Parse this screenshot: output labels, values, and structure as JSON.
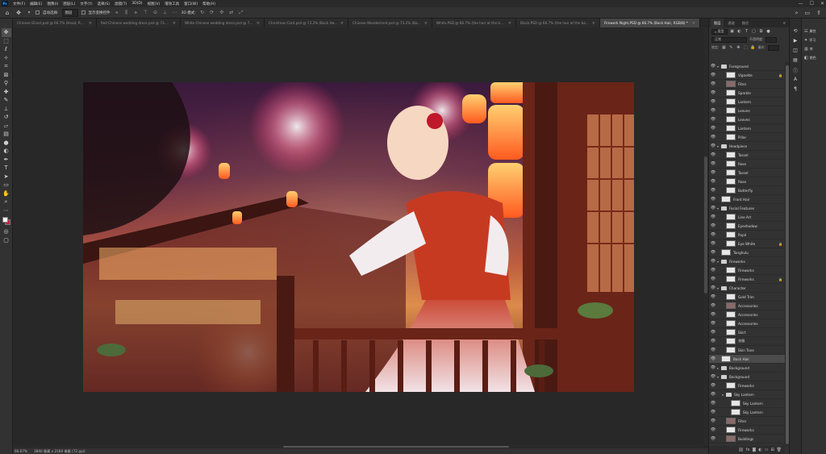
{
  "app": {
    "logo": "Ps"
  },
  "menu": [
    "文件(F)",
    "编辑(E)",
    "图像(I)",
    "图层(L)",
    "文字(Y)",
    "选择(S)",
    "滤镜(T)",
    "3D(D)",
    "视图(V)",
    "增效工具",
    "窗口(W)",
    "帮助(H)"
  ],
  "window_controls": {
    "minimize": "—",
    "maximize": "☐",
    "close": "✕"
  },
  "options": {
    "auto_select_label": "自动选择:",
    "auto_select_value": "图层",
    "show_transform_label": "显示变换控件",
    "mode_label": "3D 模式:"
  },
  "tabs": [
    {
      "label": "Chinese Ghost.psd @ 66.7% (Head, RGB/...",
      "close": "×"
    },
    {
      "label": "Red Chinese wedding dress.psd @ 73.2...",
      "close": "×"
    },
    {
      "label": "White Chinese wedding dress.psd @ 73....",
      "close": "×"
    },
    {
      "label": "Christmas Card.psd @ 73.2% (Back Hair...",
      "close": "×"
    },
    {
      "label": "Chinese Wonderland.psd @ 73.2% (Ba...",
      "close": "×"
    },
    {
      "label": "White.PSD @ 66.7% (the hair at the bac...",
      "close": "×"
    },
    {
      "label": "Black.PSD @ 66.7% (the hair at the back...",
      "close": "×"
    },
    {
      "label": "Firework Night.PSD @ 66.7% (Back Hair, RGB/8) *",
      "close": "×"
    }
  ],
  "status": {
    "zoom": "66.67%",
    "doc_info": "3840 像素 x 2160 像素 (72 ppi)"
  },
  "colors": {
    "foreground": "#ffffff",
    "background": "#c2253c",
    "accent": "#31a8ff"
  },
  "layers_panel": {
    "tabs": [
      "图层",
      "通道",
      "路径"
    ],
    "kind_label": "类型",
    "blend_mode": "正常",
    "opacity_label": "不透明度:",
    "lock_label": "锁定:",
    "fill_label": "填充:"
  },
  "layers": [
    {
      "name": "Foreground",
      "type": "group",
      "indent": 0,
      "open": true
    },
    {
      "name": "Vignette",
      "type": "layer",
      "indent": 1,
      "lock": true
    },
    {
      "name": "Filter",
      "type": "layer",
      "indent": 1,
      "dark": true
    },
    {
      "name": "Sparkle",
      "type": "layer",
      "indent": 1
    },
    {
      "name": "Lantern",
      "type": "layer",
      "indent": 1
    },
    {
      "name": "Leaves",
      "type": "layer",
      "indent": 1
    },
    {
      "name": "Leaves",
      "type": "layer",
      "indent": 1
    },
    {
      "name": "Lantern",
      "type": "layer",
      "indent": 1
    },
    {
      "name": "Pillar",
      "type": "layer",
      "indent": 1
    },
    {
      "name": "Headpiece",
      "type": "group",
      "indent": 0,
      "open": true
    },
    {
      "name": "Tassel",
      "type": "layer",
      "indent": 1
    },
    {
      "name": "Rose",
      "type": "layer",
      "indent": 1
    },
    {
      "name": "Tassel",
      "type": "layer",
      "indent": 1
    },
    {
      "name": "Rose",
      "type": "layer",
      "indent": 1
    },
    {
      "name": "Butterfly",
      "type": "layer",
      "indent": 1
    },
    {
      "name": "Front Hair",
      "type": "layer",
      "indent": 0
    },
    {
      "name": "Facial Features",
      "type": "group",
      "indent": 0,
      "open": true
    },
    {
      "name": "Line Art",
      "type": "layer",
      "indent": 1
    },
    {
      "name": "Eyeshadow",
      "type": "layer",
      "indent": 1
    },
    {
      "name": "Pupil",
      "type": "layer",
      "indent": 1
    },
    {
      "name": "Eye White",
      "type": "layer",
      "indent": 1,
      "lock": true
    },
    {
      "name": "Tanghulu",
      "type": "layer",
      "indent": 0
    },
    {
      "name": "Fireworks",
      "type": "group",
      "indent": 0,
      "open": true
    },
    {
      "name": "Fireworks",
      "type": "layer",
      "indent": 1
    },
    {
      "name": "Fireworks",
      "type": "layer",
      "indent": 1,
      "lock": true
    },
    {
      "name": "Character",
      "type": "group",
      "indent": 0,
      "open": true
    },
    {
      "name": "Gold Trim",
      "type": "layer",
      "indent": 1
    },
    {
      "name": "Accessories",
      "type": "layer",
      "indent": 1,
      "dark": true
    },
    {
      "name": "Accessories",
      "type": "layer",
      "indent": 1
    },
    {
      "name": "Accessories",
      "type": "layer",
      "indent": 1
    },
    {
      "name": "Skirt",
      "type": "layer",
      "indent": 1
    },
    {
      "name": "衣服",
      "type": "layer",
      "indent": 1
    },
    {
      "name": "Skin Tone",
      "type": "layer",
      "indent": 1
    },
    {
      "name": "Back Hair",
      "type": "layer",
      "indent": 0,
      "selected": true
    },
    {
      "name": "Background",
      "type": "group",
      "indent": 0,
      "open": false
    },
    {
      "name": "Background",
      "type": "group",
      "indent": 0,
      "open": true
    },
    {
      "name": "Fireworks",
      "type": "layer",
      "indent": 1
    },
    {
      "name": "Sky Lantern",
      "type": "group",
      "indent": 1,
      "open": true
    },
    {
      "name": "Sky Lantern",
      "type": "layer",
      "indent": 2
    },
    {
      "name": "Sky Lantern",
      "type": "layer",
      "indent": 2
    },
    {
      "name": "Filter",
      "type": "layer",
      "indent": 1,
      "dark": true
    },
    {
      "name": "Fireworks",
      "type": "layer",
      "indent": 1
    },
    {
      "name": "Buildings",
      "type": "layer",
      "indent": 1,
      "dark": true
    }
  ],
  "properties_strip": [
    {
      "icon": "adjustments-icon",
      "label": "属性"
    },
    {
      "icon": "learn-icon",
      "label": "学习"
    },
    {
      "icon": "libraries-icon",
      "label": "库"
    },
    {
      "icon": "comments-icon",
      "label": "颜色"
    }
  ],
  "artwork": {
    "title": "Firework Night"
  }
}
